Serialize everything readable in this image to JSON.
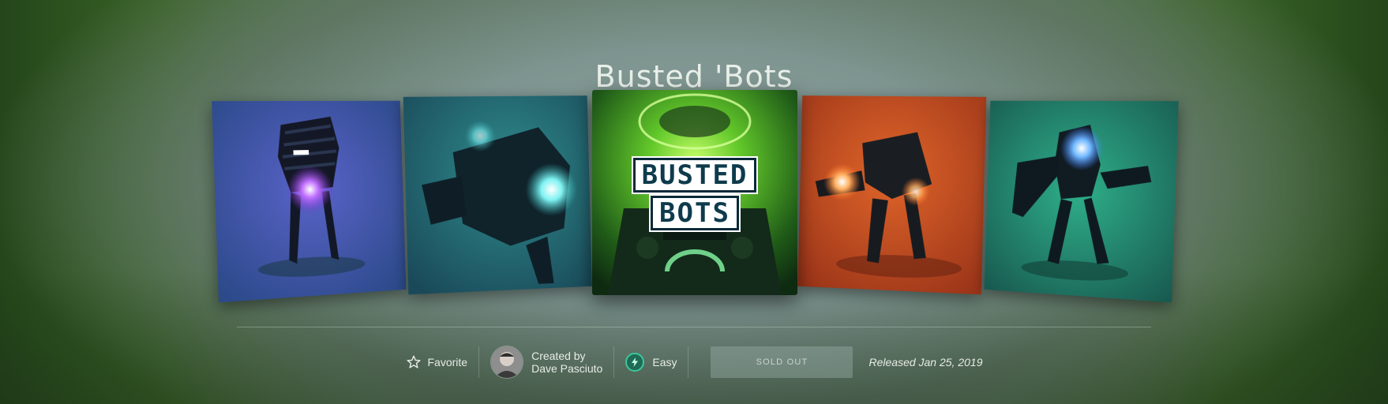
{
  "page": {
    "title": "Busted 'Bots"
  },
  "carousel": {
    "cards": [
      {
        "name": "purple-robot-art",
        "accent": "#9b46e8"
      },
      {
        "name": "teal-robot-art",
        "accent": "#4fe0e0"
      },
      {
        "name": "busted-bots-cover-art",
        "accent": "#7fe03a"
      },
      {
        "name": "orange-robot-art",
        "accent": "#ff8a2a"
      },
      {
        "name": "green-robot-art",
        "accent": "#48a8ff"
      }
    ],
    "logo_line_1": "BUSTED",
    "logo_line_2": "BOTS"
  },
  "info": {
    "favorite_label": "Favorite",
    "favorite_icon": "star-outline-icon",
    "created_by_label": "Created by",
    "creator_name": "Dave Pasciuto",
    "difficulty_icon": "lightning-icon",
    "difficulty": "Easy",
    "status_button": "SOLD OUT",
    "released": "Released Jan 25, 2019"
  }
}
